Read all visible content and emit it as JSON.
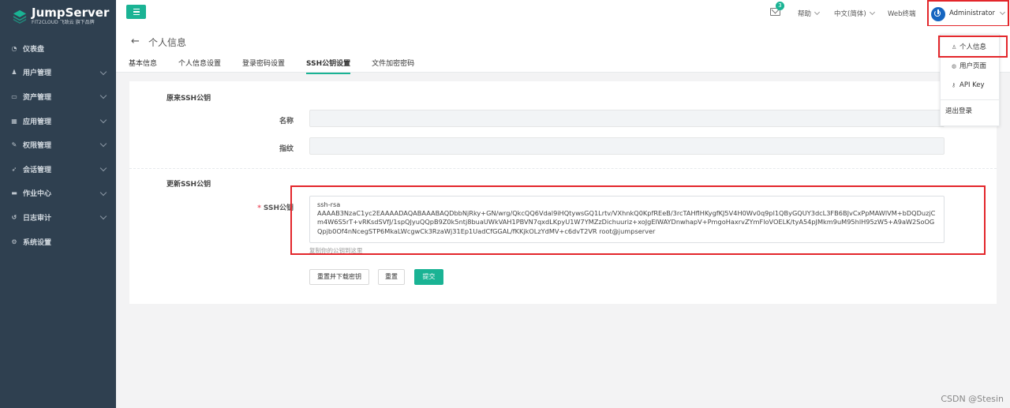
{
  "brand": {
    "name": "JumpServer",
    "subtitle": "FIT2CLOUD 飞致云 旗下品牌"
  },
  "sidebar": {
    "items": [
      {
        "label": "仪表盘",
        "icon": "dashboard-icon",
        "has_children": false
      },
      {
        "label": "用户管理",
        "icon": "users-icon",
        "has_children": true
      },
      {
        "label": "资产管理",
        "icon": "inbox-icon",
        "has_children": true
      },
      {
        "label": "应用管理",
        "icon": "grid-icon",
        "has_children": true
      },
      {
        "label": "权限管理",
        "icon": "edit-icon",
        "has_children": true
      },
      {
        "label": "会话管理",
        "icon": "rocket-icon",
        "has_children": true
      },
      {
        "label": "作业中心",
        "icon": "coffee-icon",
        "has_children": true
      },
      {
        "label": "日志审计",
        "icon": "history-icon",
        "has_children": true
      },
      {
        "label": "系统设置",
        "icon": "gears-icon",
        "has_children": false
      }
    ]
  },
  "topbar": {
    "notifications_count": "3",
    "help": "帮助",
    "language": "中文(简体)",
    "web_terminal": "Web终端",
    "user": "Administrator"
  },
  "user_menu": {
    "items": [
      {
        "label": "个人信息",
        "icon": "user-icon"
      },
      {
        "label": "用户页面",
        "icon": "globe-icon"
      },
      {
        "label": "API Key",
        "icon": "key-icon"
      },
      {
        "label": "退出登录",
        "icon": ""
      }
    ]
  },
  "page": {
    "title": "个人信息",
    "tabs": [
      "基本信息",
      "个人信息设置",
      "登录密码设置",
      "SSH公钥设置",
      "文件加密密码"
    ],
    "active_tab": "SSH公钥设置"
  },
  "form": {
    "original_section": "原来SSH公钥",
    "name_label": "名称",
    "name_value": "",
    "fingerprint_label": "指纹",
    "fingerprint_value": "",
    "update_section": "更新SSH公钥",
    "ssh_label": "SSH公钥",
    "ssh_value": "ssh-rsa\nAAAAB3NzaC1yc2EAAAADAQABAAABAQDbbNjRky+GN/wrg/QkcQQ6Vdal9iHQtywsGQ1Lrtv/VXhnkQ0KpfREeB/3rcTAHflHKygfKJ5V4H0Wv0q9pl1QByGQUY3dcL3FB6BJvCxPpMAWlVM+bDQDuzjCm4W6S5rT+vRKsdSVfJ/1spQJyuQQpB9Z0k5ntj8buaUWkVAH1PBVN7qxdLKpyU1W7YMZzDichuuriz+xoJgEIWAYDnwhapV+PmgoHaxrvZYmFloVOELK/tyA54pJMkm9uM95hlH95zW5+A9aW2SoOGQpjb0Of4nNcegSTP6MkaLWcgwCk3RzaWj31Ep1UadCfGGAL/fKKjkOLzYdMV+c6dvT2VR root@jumpserver",
    "ssh_help": "复制你的公钥到这里",
    "buttons": {
      "reset_download": "重置并下载密钥",
      "reset": "重置",
      "submit": "提交"
    }
  },
  "watermark": "CSDN @Stesin"
}
